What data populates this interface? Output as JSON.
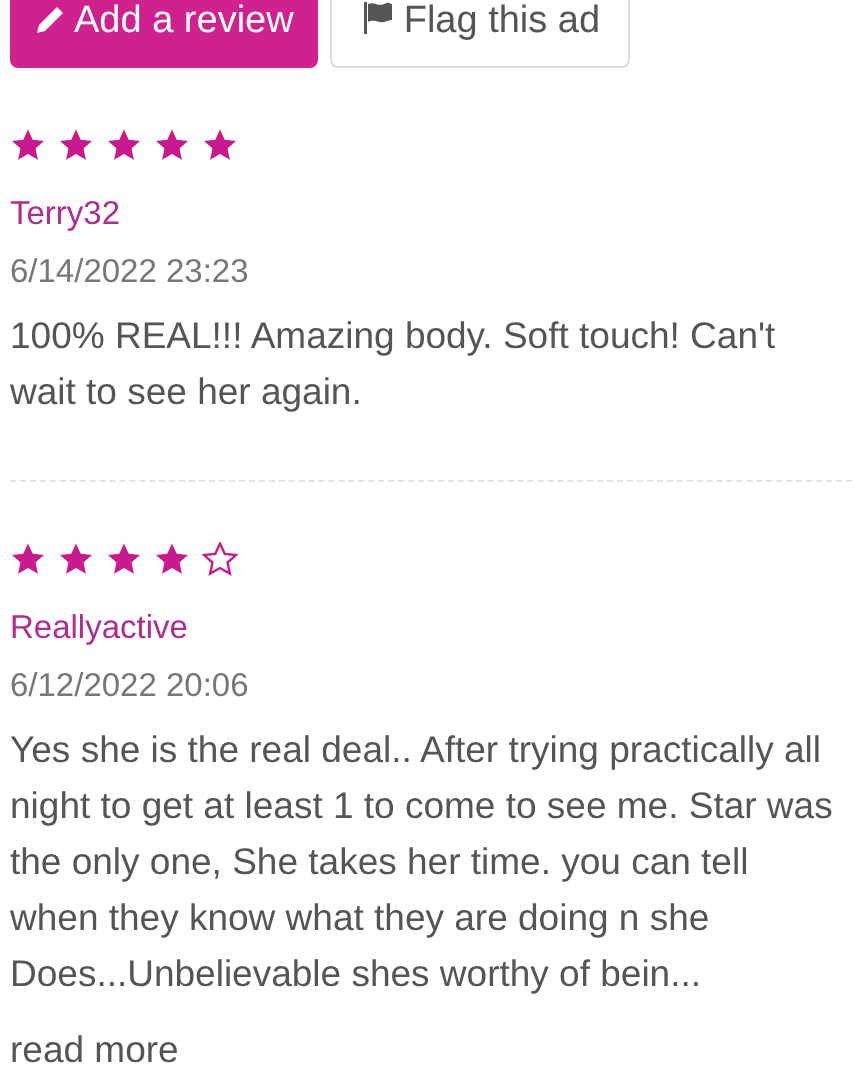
{
  "buttons": [
    {
      "kind": "primary",
      "label": "Add a review"
    },
    {
      "kind": "secondary",
      "label": "Flag this ad"
    }
  ],
  "reviews": [
    {
      "stars": 5,
      "author": "Terry32",
      "date": "6/14/2022 23:23",
      "text": "100% REAL!!! Amazing body. Soft touch! Can't wait to see her again."
    },
    {
      "stars": 4,
      "author": "Reallyactive",
      "date": "6/12/2022 20:06",
      "text": "Yes she is the real deal.. After trying practically all night to get at least 1 to come to see me. Star was the only one, She takes her time. you can tell when they know what they are doing n she Does...Unbelievable shes worthy of bein...",
      "more": "read more"
    }
  ]
}
